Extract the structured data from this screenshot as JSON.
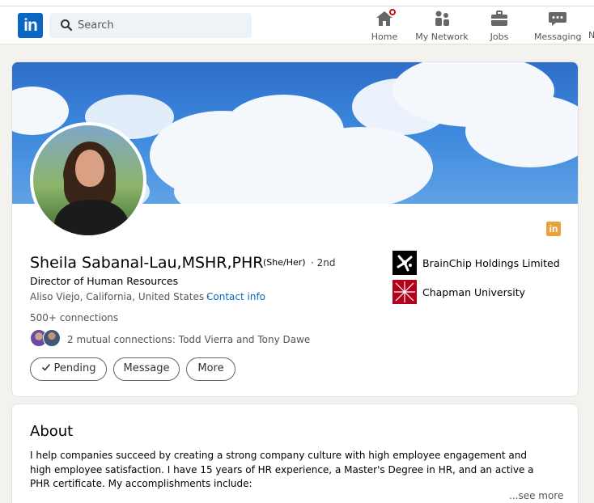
{
  "nav": {
    "logo": "in",
    "search_placeholder": "Search",
    "items": [
      {
        "label": "Home",
        "icon": "home-icon"
      },
      {
        "label": "My Network",
        "icon": "network-icon"
      },
      {
        "label": "Jobs",
        "icon": "briefcase-icon"
      },
      {
        "label": "Messaging",
        "icon": "messaging-icon"
      }
    ],
    "overflow_letter": "N"
  },
  "profile": {
    "name": "Sheila Sabanal-Lau,MSHR,PHR",
    "pronouns": "(She/Her)",
    "degree": "· 2nd",
    "headline": "Director of Human Resources",
    "location": "Aliso Viejo, California, United States ·",
    "contact_info": "Contact info",
    "connections": "500+ connections",
    "mutual": "2 mutual connections: Todd Vierra and Tony Dawe",
    "buttons": {
      "pending": "Pending",
      "message": "Message",
      "more": "More"
    },
    "badge_letters": "in",
    "experience": [
      {
        "label": "BrainChip Holdings Limited",
        "icon": "brainchip-logo"
      },
      {
        "label": "Chapman University",
        "icon": "chapman-logo"
      }
    ]
  },
  "about": {
    "title": "About",
    "text": "I help companies succeed by creating a strong company culture with high employee engagement and high employee satisfaction. I have 15 years of HR experience, a Master's Degree in HR, and an active a PHR certificate. My accomplishments include:",
    "see_more": "...see more"
  },
  "colors": {
    "linkedin_blue": "#0a66c2",
    "notification_red": "#cc1016",
    "badge_orange": "#e7a33e"
  }
}
